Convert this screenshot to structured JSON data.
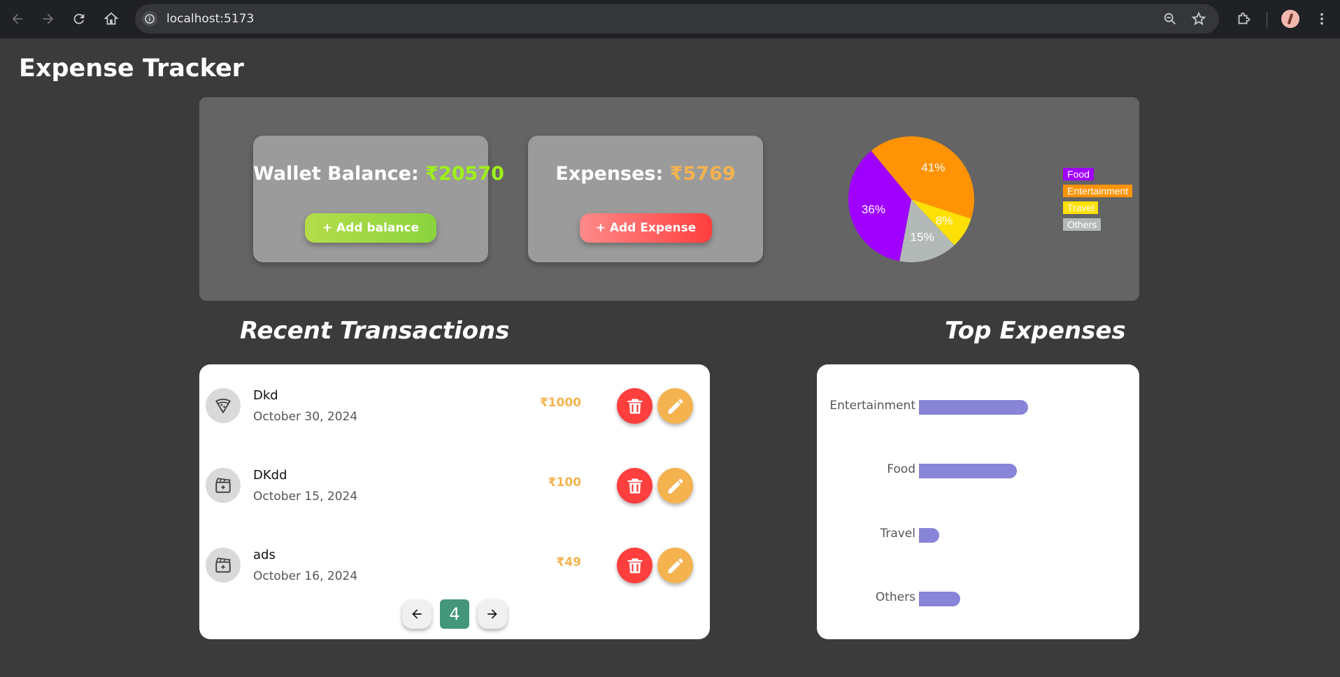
{
  "browser": {
    "url": "localhost:5173"
  },
  "page": {
    "title": "Expense Tracker"
  },
  "wallet": {
    "label": "Wallet Balance:",
    "amount": "₹20570",
    "button": "+ Add balance"
  },
  "expenses": {
    "label": "Expenses:",
    "amount": "₹5769",
    "button": "+ Add Expense"
  },
  "chart_data": [
    {
      "type": "pie",
      "labels": [
        "Food",
        "Entertainment",
        "Travel",
        "Others"
      ],
      "values": [
        36,
        41,
        8,
        15
      ],
      "value_labels": [
        "36%",
        "41%",
        "8%",
        "15%"
      ],
      "colors": [
        "#a000ff",
        "#ff9304",
        "#fde006",
        "#b3b9b6"
      ],
      "legend_placement": "right"
    },
    {
      "type": "bar",
      "orientation": "horizontal",
      "title": "Top Expenses",
      "categories": [
        "Entertainment",
        "Food",
        "Travel",
        "Others"
      ],
      "values": [
        2400,
        2150,
        450,
        900
      ],
      "color": "#8884d8"
    }
  ],
  "sections": {
    "recent": "Recent Transactions",
    "top": "Top Expenses"
  },
  "transactions": [
    {
      "name": "Dkd",
      "date": "October 30, 2024",
      "amount": "₹1000",
      "icon": "pizza-icon"
    },
    {
      "name": "DKdd",
      "date": "October 15, 2024",
      "amount": "₹100",
      "icon": "movie-icon"
    },
    {
      "name": "ads",
      "date": "October 16, 2024",
      "amount": "₹49",
      "icon": "movie-icon"
    }
  ],
  "pagination": {
    "current": "4"
  }
}
